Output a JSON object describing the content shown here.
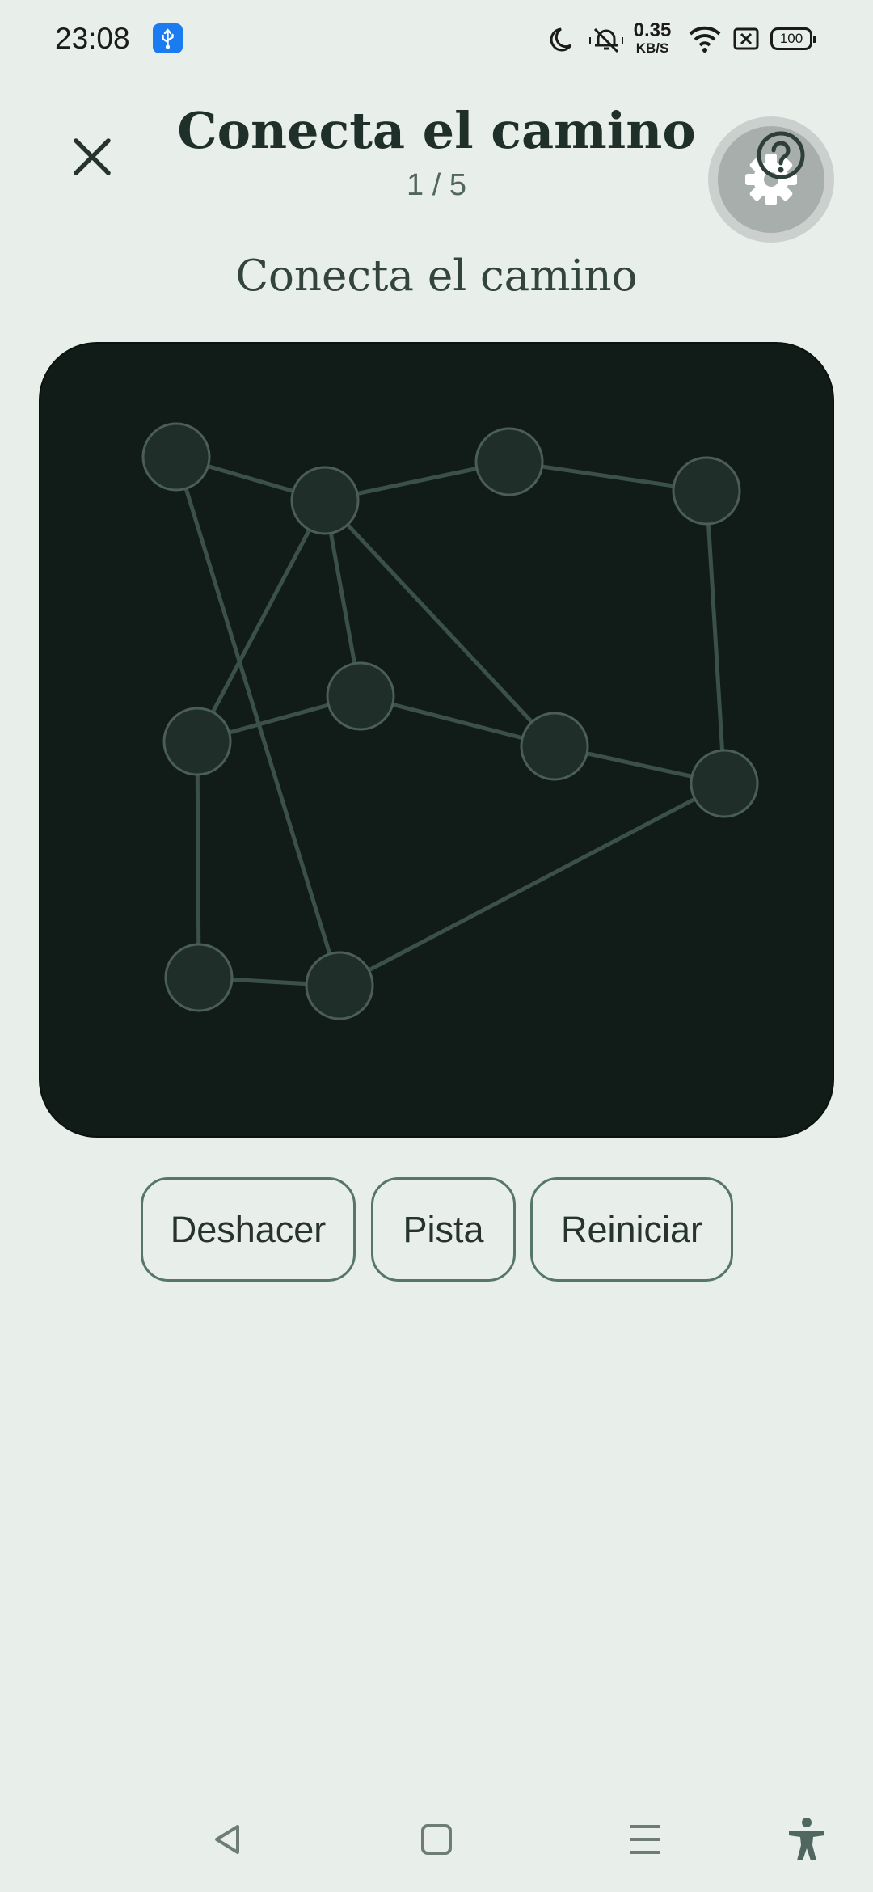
{
  "status_bar": {
    "time": "23:08",
    "net_speed_value": "0.35",
    "net_speed_unit": "KB/S",
    "battery_level": "100",
    "icons": [
      "usb-icon",
      "moon-icon",
      "silent-icon",
      "wifi-icon",
      "sim-off-icon",
      "battery-icon"
    ]
  },
  "header": {
    "title": "Conecta el camino",
    "progress": "1 / 5",
    "close_icon": "close-icon",
    "fab_icons": [
      "settings-gear-icon",
      "help-icon"
    ]
  },
  "puzzle": {
    "subtitle": "Conecta el camino",
    "node_ids": [
      "n1",
      "n2",
      "n3",
      "n4",
      "n5",
      "n6",
      "n7",
      "n8",
      "n9",
      "n10"
    ],
    "edges": [
      [
        "n1",
        "n2"
      ],
      [
        "n2",
        "n3"
      ],
      [
        "n3",
        "n4"
      ],
      [
        "n1",
        "n10"
      ],
      [
        "n2",
        "n5"
      ],
      [
        "n2",
        "n6"
      ],
      [
        "n2",
        "n7"
      ],
      [
        "n4",
        "n8"
      ],
      [
        "n5",
        "n6"
      ],
      [
        "n6",
        "n7"
      ],
      [
        "n7",
        "n8"
      ],
      [
        "n5",
        "n9"
      ],
      [
        "n9",
        "n10"
      ],
      [
        "n10",
        "n8"
      ]
    ],
    "colors": {
      "board": "#111c18",
      "node_fill": "#1f2e28",
      "node_stroke": "#4a5e57",
      "edge": "#3b5048"
    }
  },
  "actions": {
    "undo": "Deshacer",
    "hint": "Pista",
    "reset": "Reiniciar"
  },
  "nav_bar": {
    "icons": [
      "back-icon",
      "home-icon",
      "recents-icon",
      "accessibility-icon"
    ]
  }
}
